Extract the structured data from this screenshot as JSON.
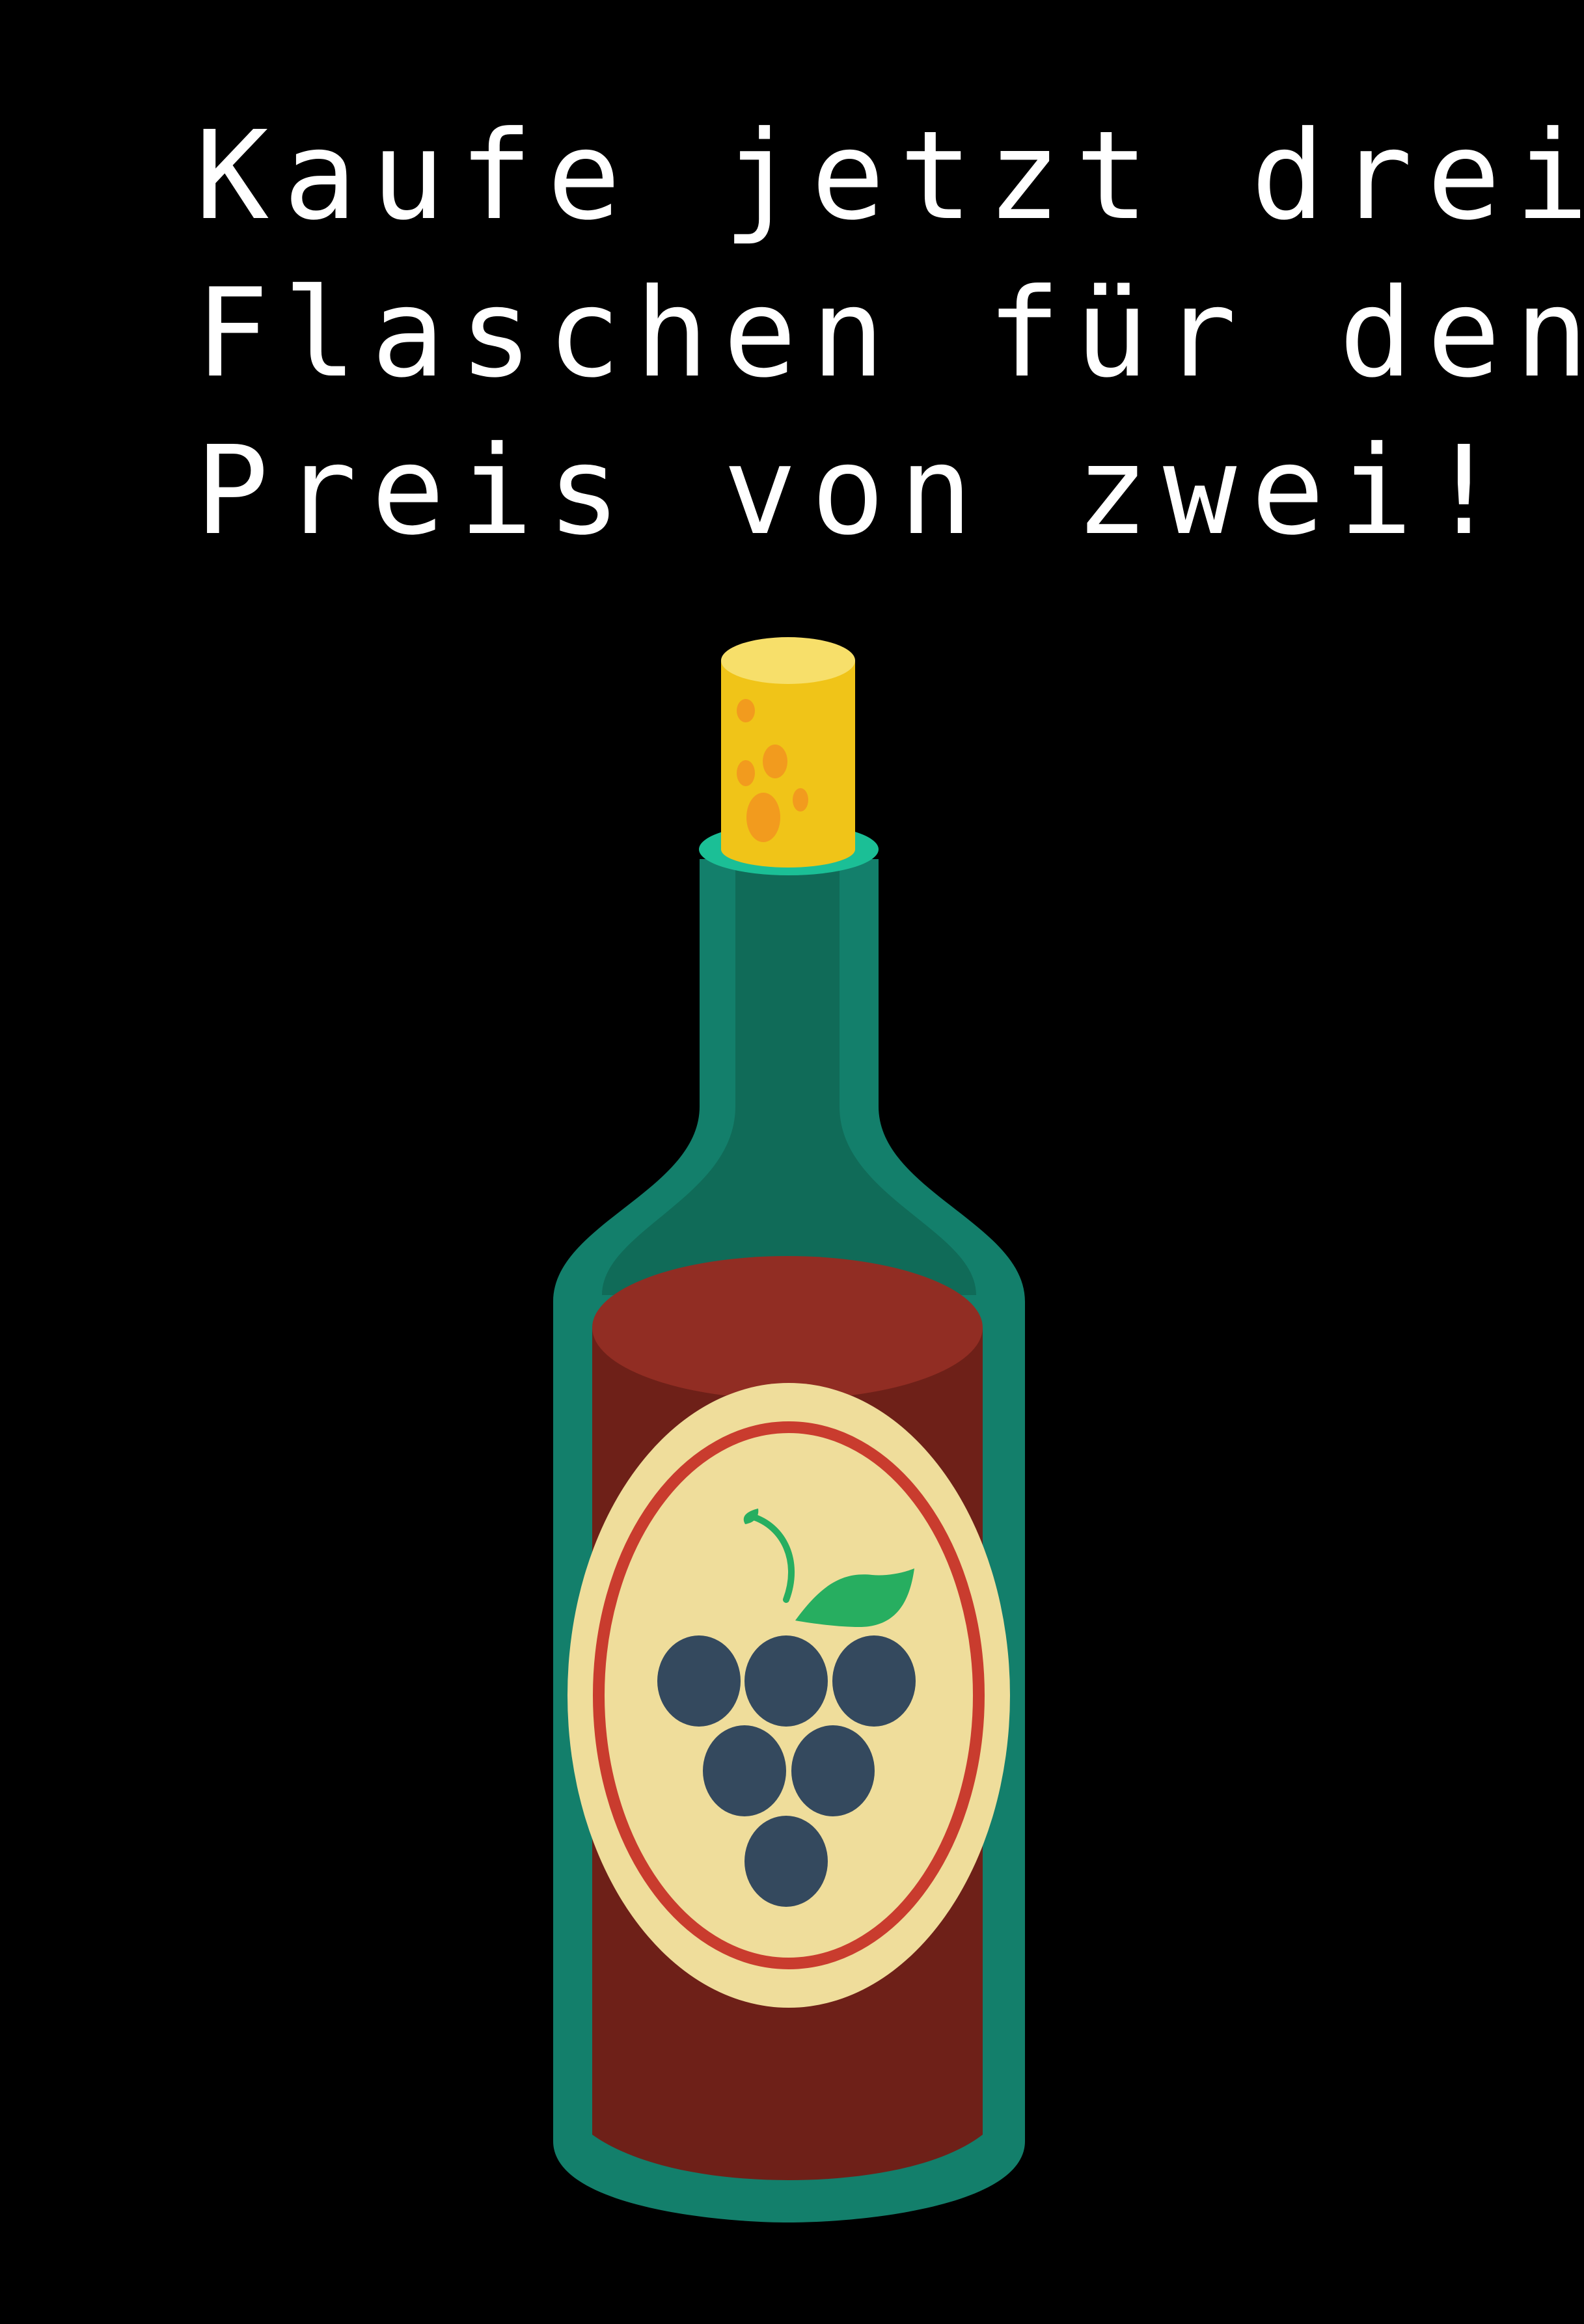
{
  "headline": {
    "lines": [
      "Kaufe jetzt drei",
      "Flaschen für den",
      "Preis von zwei!"
    ]
  },
  "illustration": {
    "subject": "wine-bottle",
    "label_icon": "grapes-icon",
    "colors": {
      "background": "#000000",
      "text": "#ffffff",
      "bottle_glass": "#137f6b",
      "bottle_glass_dark": "#106b58",
      "bottle_rim": "#1bbf96",
      "cork": "#f0c418",
      "cork_spots": "#f29b1e",
      "wine": "#6e2018",
      "wine_top": "#912d23",
      "label": "#efdd9b",
      "label_ring": "#c93c2e",
      "grapes": "#34495e",
      "leaf": "#27ae60"
    }
  }
}
